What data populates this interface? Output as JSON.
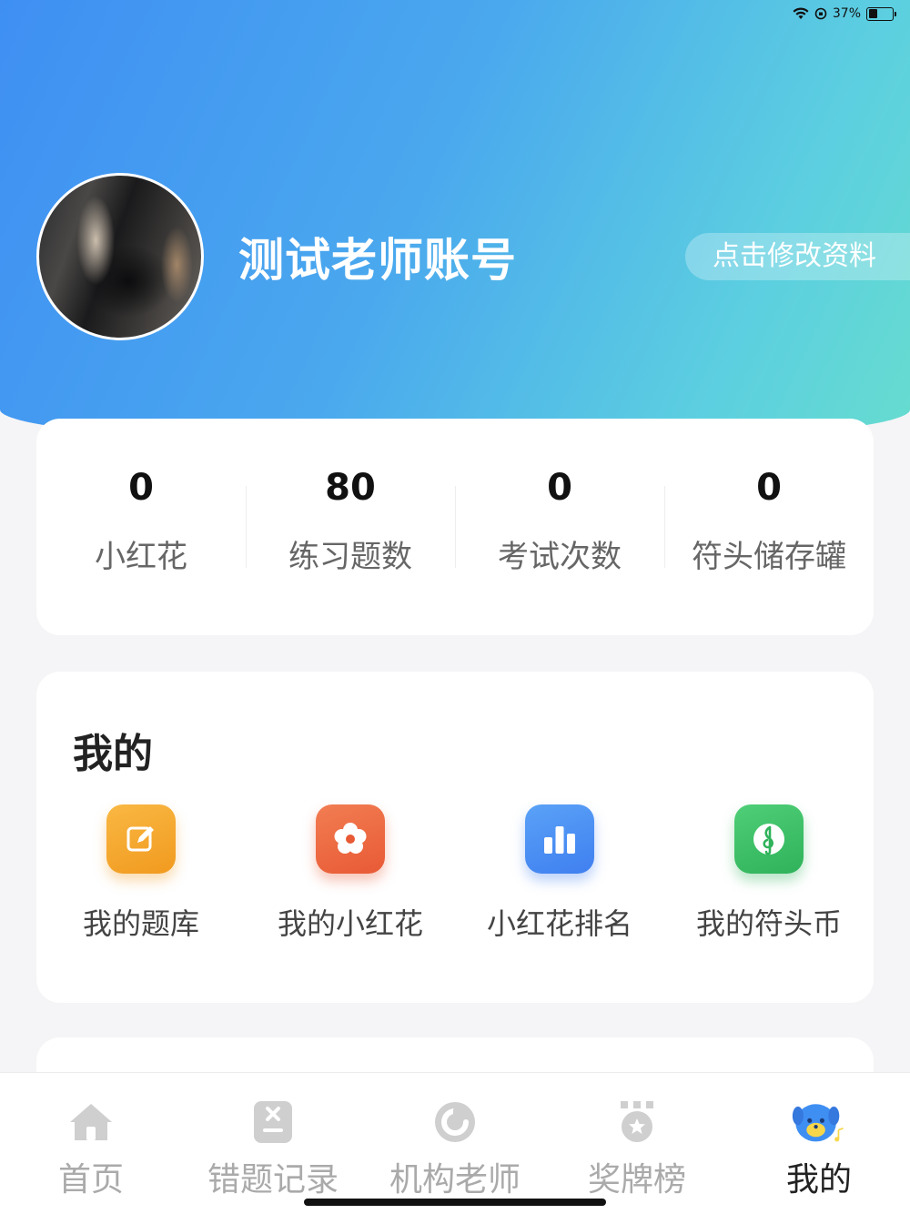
{
  "status_bar": {
    "battery": "37%",
    "battery_level": 0.37
  },
  "profile": {
    "name": "测试老师账号",
    "edit_label": "点击修改资料"
  },
  "stats": [
    {
      "value": "0",
      "label": "小红花"
    },
    {
      "value": "80",
      "label": "练习题数"
    },
    {
      "value": "0",
      "label": "考试次数"
    },
    {
      "value": "0",
      "label": "符头储存罐"
    }
  ],
  "my_section": {
    "title": "我的",
    "items": [
      {
        "label": "我的题库",
        "icon": "edit-icon",
        "color": "#f5a623"
      },
      {
        "label": "我的小红花",
        "icon": "flower-icon",
        "color": "#ee6b43"
      },
      {
        "label": "小红花排名",
        "icon": "bar-chart-icon",
        "color": "#4d8ff5"
      },
      {
        "label": "我的符头币",
        "icon": "treble-clef-icon",
        "color": "#3cc265"
      }
    ]
  },
  "tabbar": {
    "tabs": [
      {
        "label": "首页",
        "icon": "home-icon",
        "active": false
      },
      {
        "label": "错题记录",
        "icon": "wrong-record-icon",
        "active": false
      },
      {
        "label": "机构老师",
        "icon": "teacher-icon",
        "active": false
      },
      {
        "label": "奖牌榜",
        "icon": "medal-icon",
        "active": false
      },
      {
        "label": "我的",
        "icon": "mascot-icon",
        "active": true
      }
    ],
    "active_color": "#222222",
    "inactive_color": "#aaaaaa"
  }
}
